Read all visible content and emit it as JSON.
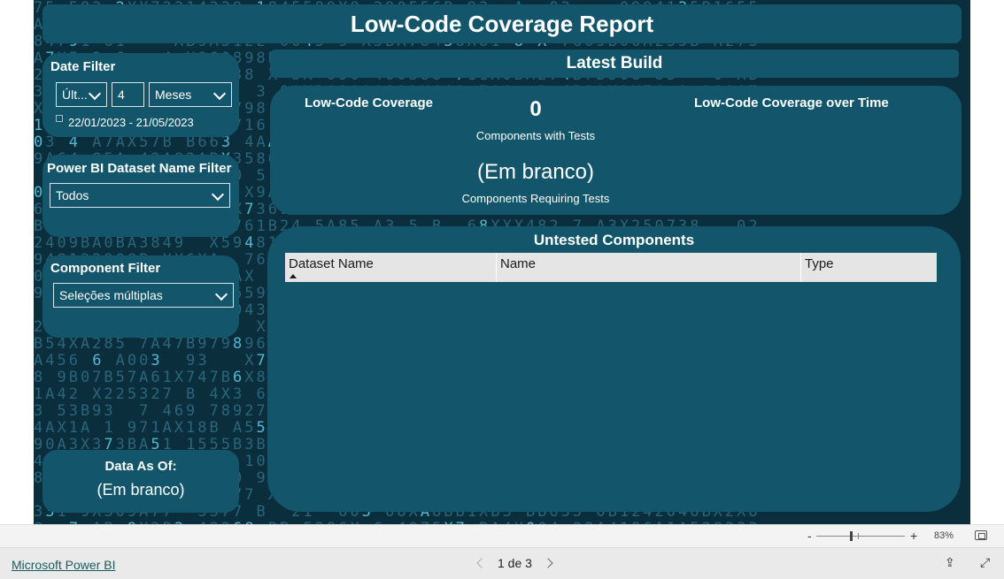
{
  "report": {
    "title": "Low-Code Coverage Report"
  },
  "date_filter": {
    "title": "Date Filter",
    "period_value": "Últ...",
    "count_value": "4",
    "unit_value": "Meses",
    "range_text": "22/01/2023 - 21/05/2023"
  },
  "dataset_filter": {
    "title": "Power BI Dataset Name Filter",
    "value": "Todos"
  },
  "component_filter": {
    "title": "Component Filter",
    "value": "Seleções múltiplas"
  },
  "data_as_of": {
    "title": "Data As Of:",
    "value": "(Em branco)"
  },
  "latest_build": {
    "title": "Latest Build"
  },
  "kpis": {
    "coverage_label": "Low-Code Coverage",
    "coverage_over_time_label": "Low-Code Coverage over Time",
    "components_with_tests_value": "0",
    "components_with_tests_label": "Components with Tests",
    "components_requiring_tests_value": "(Em branco)",
    "components_requiring_tests_label": "Components Requiring Tests"
  },
  "untested": {
    "title": "Untested Components",
    "columns": [
      "Dataset Name",
      "Name",
      "Type"
    ]
  },
  "status_bar": {
    "zoom_minus": "-",
    "zoom_plus": "+",
    "zoom_level": "83%"
  },
  "footer": {
    "app_link": "Microsoft Power BI",
    "page_indicator": "1 de 3"
  },
  "colors": {
    "canvas_bg": "#0b2e3d",
    "card_bg": "#13566b",
    "accent_text": "#ffffff"
  }
}
